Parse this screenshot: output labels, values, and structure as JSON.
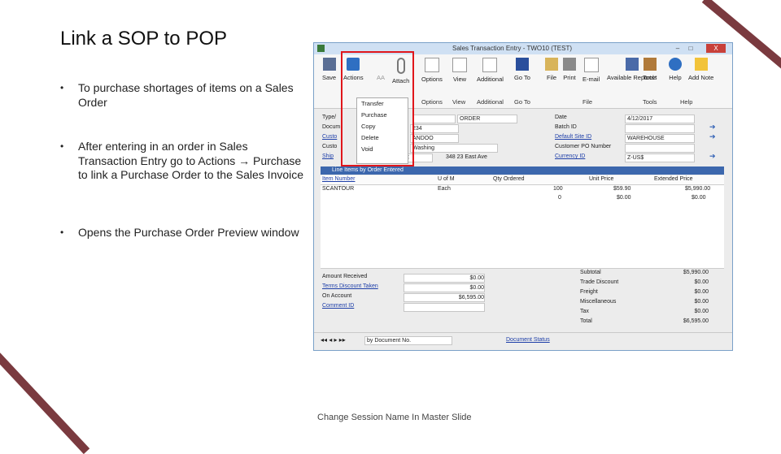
{
  "slide": {
    "title": "Link a SOP to POP",
    "bullets": [
      "To purchase shortages of items on a Sales Order",
      "After entering in an order in Sales Transaction Entry go to Actions → Purchase to link a Purchase Order to the Sales Invoice",
      "Opens the Purchase Order Preview window"
    ],
    "footer": "Change Session Name In Master Slide"
  },
  "window": {
    "title": "Sales Transaction Entry  -  TWO10 (TEST)",
    "controls": {
      "minimize": "–",
      "maximize": "□",
      "close": "X"
    },
    "ribbon": {
      "buttons": [
        "Save",
        "Actions",
        "AA",
        "Attach",
        "Options",
        "View",
        "Additional",
        "Go To",
        "File",
        "Print",
        "E-mail",
        "Available Reports*",
        "Tools",
        "Help",
        "Add Note"
      ],
      "groups": [
        "Actions",
        "Options",
        "View",
        "Additional",
        "Go To",
        "File",
        "Tools",
        "Help"
      ]
    },
    "actions_menu": [
      "Transfer",
      "Purchase",
      "Copy",
      "Delete",
      "Void"
    ],
    "header": {
      "type_label": "Type/",
      "order_label": "Docum",
      "customer_label": "Custo",
      "customer_name_label": "Custo",
      "ship_label": "Ship",
      "type_value": "ORDER",
      "order_value": "234",
      "customer_id": "ANDOO",
      "customer_name_value": "Washing",
      "ship_value": "RESIDE",
      "ship_address": "348 23 East Ave",
      "date_label": "Date",
      "date_value": "4/12/2017",
      "batch_label": "Batch ID",
      "site_label": "Default Site ID",
      "site_value": "WAREHOUSE",
      "po_label": "Customer PO Number",
      "currency_label": "Currency ID",
      "currency_value": "Z-US$"
    },
    "grid": {
      "title": "Line Items by Order Entered",
      "columns": [
        "Item Number",
        "U of M",
        "Qty Ordered",
        "Unit Price",
        "Extended Price"
      ],
      "rows": [
        {
          "item": "SCANTOUR",
          "uom": "Each",
          "qty": "100",
          "unit_price": "$59.90",
          "extended": "$5,990.00"
        },
        {
          "item": "",
          "uom": "",
          "qty": "0",
          "unit_price": "$0.00",
          "extended": "$0.00"
        }
      ]
    },
    "footer_left": {
      "amount_received_label": "Amount Received",
      "amount_received": "$0.00",
      "terms_label": "Terms Discount Taken",
      "terms": "$0.00",
      "on_account_label": "On Account",
      "on_account": "$6,595.00",
      "comment_label": "Comment ID"
    },
    "totals": [
      {
        "label": "Subtotal",
        "value": "$5,990.00"
      },
      {
        "label": "Trade Discount",
        "value": "$0.00"
      },
      {
        "label": "Freight",
        "value": "$0.00"
      },
      {
        "label": "Miscellaneous",
        "value": "$0.00"
      },
      {
        "label": "Tax",
        "value": "$0.00"
      },
      {
        "label": "Total",
        "value": "$6,595.00"
      }
    ],
    "status": {
      "sort": "by Document No.",
      "document_status": "Document Status"
    }
  },
  "colors": {
    "accent": "#7a3a3f",
    "highlight": "#e0161b",
    "grid_header": "#3c67ad"
  }
}
